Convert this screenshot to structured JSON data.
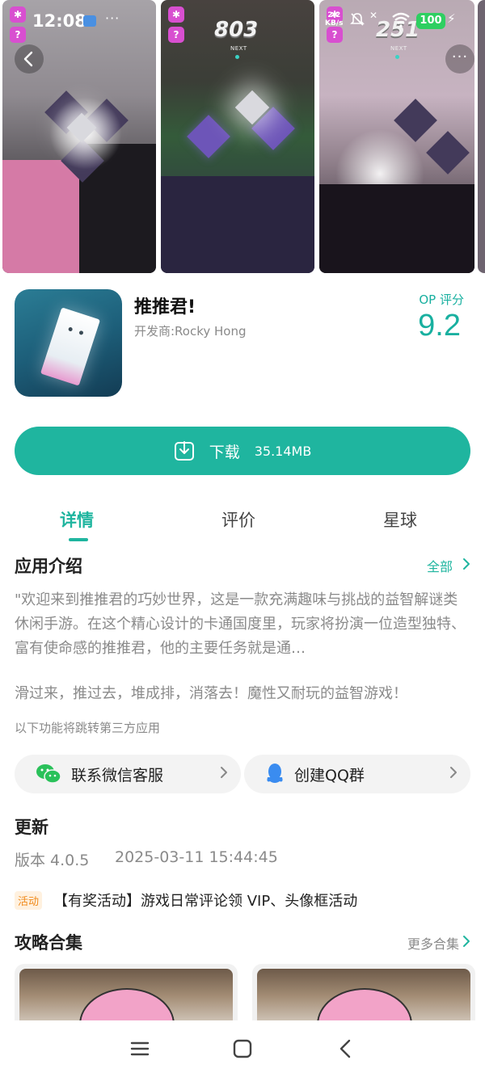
{
  "status_bar": {
    "time": "12:08",
    "more": "···",
    "net_rate_value": "2.2",
    "net_rate_unit": "KB/s",
    "battery": "100"
  },
  "screenshots": {
    "shot2_score": "803",
    "shot3_score": "251",
    "next_label": "NEXT",
    "more_menu": "···"
  },
  "app": {
    "name": "推推君!",
    "developer": "开发商:Rocky Hong",
    "rating_label": "OP 评分",
    "rating_value": "9.2"
  },
  "download": {
    "label": "下载",
    "size": "35.14MB"
  },
  "tabs": [
    {
      "label": "详情",
      "active": true
    },
    {
      "label": "评价",
      "active": false
    },
    {
      "label": "星球",
      "active": false
    }
  ],
  "intro": {
    "title": "应用介绍",
    "see_all": "全部",
    "text": "\"欢迎来到推推君的巧妙世界，这是一款充满趣味与挑战的益智解谜类休闲手游。在这个精心设计的卡通国度里，玩家将扮演一位造型独特、富有使命感的推推君，他的主要任务就是通…",
    "slogan": "滑过来，推过去，堆成排，消落去！魔性又耐玩的益智游戏！",
    "third_party_note": "以下功能将跳转第三方应用"
  },
  "contact": {
    "wechat_label": "联系微信客服",
    "qq_label": "创建QQ群"
  },
  "update": {
    "title": "更新",
    "version": "版本 4.0.5",
    "date": "2025-03-11 15:44:45"
  },
  "activity": {
    "tag": "活动",
    "text": "【有奖活动】游戏日常评论领 VIP、头像框活动"
  },
  "guides": {
    "title": "攻略合集",
    "more": "更多合集"
  },
  "colors": {
    "accent": "#1fb59f",
    "activity_tag": "#f08a1b",
    "wechat": "#2ac15a",
    "qq": "#3a8cf0"
  },
  "icons": [
    "back-arrow-icon",
    "more-dots-icon",
    "download-icon",
    "chevron-right-icon",
    "wechat-icon",
    "qq-icon",
    "menu-icon",
    "home-square-icon",
    "nav-back-icon"
  ]
}
